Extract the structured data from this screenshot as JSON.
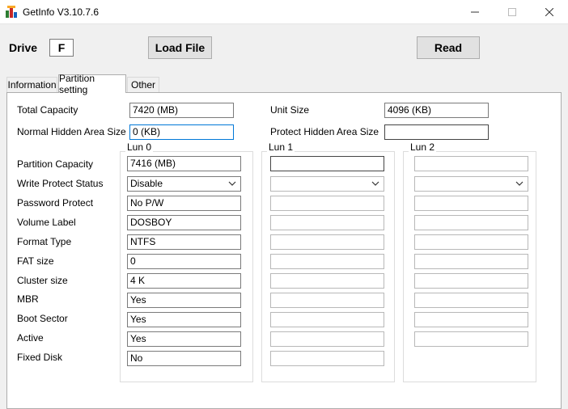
{
  "window": {
    "title": "GetInfo V3.10.7.6"
  },
  "drive": {
    "label": "Drive",
    "value": "F"
  },
  "buttons": {
    "load_file": "Load File",
    "read": "Read"
  },
  "tabs": [
    "Information",
    "Partition setting",
    "Other"
  ],
  "top": {
    "total_capacity_label": "Total Capacity",
    "total_capacity_value": "7420 (MB)",
    "unit_size_label": "Unit Size",
    "unit_size_value": "4096 (KB)",
    "normal_hidden_label": "Normal Hidden Area Size",
    "normal_hidden_value": "0 (KB)",
    "protect_hidden_label": "Protect Hidden Area Size",
    "protect_hidden_value": ""
  },
  "rows": [
    "Partition Capacity",
    "Write Protect Status",
    "Password Protect",
    "Volume Label",
    "Format Type",
    "FAT size",
    "Cluster size",
    "MBR",
    "Boot Sector",
    "Active",
    "Fixed Disk"
  ],
  "luns": [
    {
      "title": "Lun 0",
      "values": [
        "7416 (MB)",
        "Disable",
        "No P/W",
        "DOSBOY",
        "NTFS",
        "0",
        "4 K",
        "Yes",
        "Yes",
        "Yes",
        "No"
      ]
    },
    {
      "title": "Lun 1",
      "values": [
        "",
        "",
        "",
        "",
        "",
        "",
        "",
        "",
        "",
        "",
        ""
      ]
    },
    {
      "title": "Lun 2",
      "values": [
        "",
        "",
        "",
        "",
        "",
        "",
        "",
        "",
        "",
        ""
      ]
    }
  ]
}
